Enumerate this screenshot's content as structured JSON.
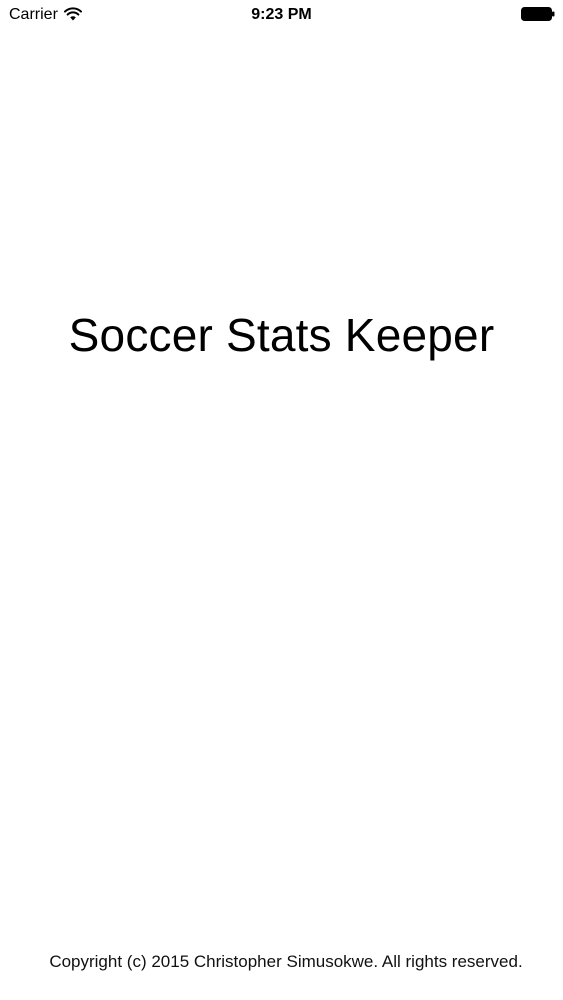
{
  "status_bar": {
    "carrier": "Carrier",
    "time": "9:23 PM",
    "wifi_icon": "wifi-icon",
    "battery_icon": "battery-icon"
  },
  "splash": {
    "title": "Soccer Stats Keeper",
    "copyright": "Copyright (c) 2015 Christopher Simusokwe. All rights reserved."
  },
  "colors": {
    "background": "#ffffff",
    "text": "#000000"
  }
}
